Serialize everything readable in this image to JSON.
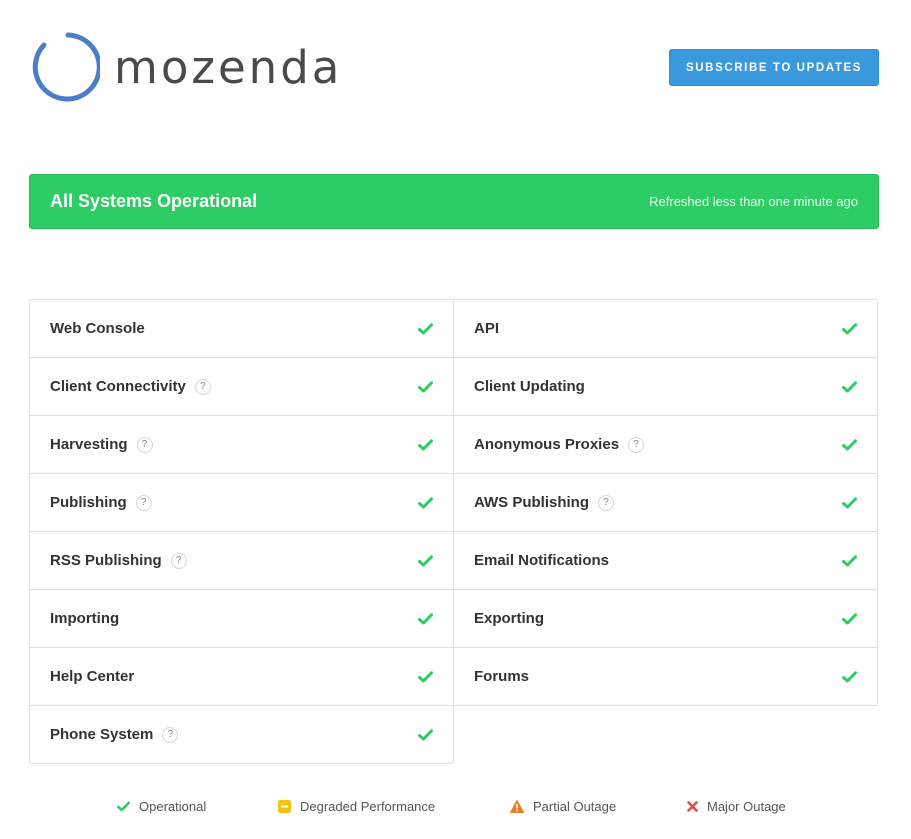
{
  "header": {
    "logo_text": "mozenda",
    "subscribe_label": "SUBSCRIBE TO UPDATES"
  },
  "banner": {
    "title": "All Systems Operational",
    "refresh_text": "Refreshed less than one minute ago",
    "color": "#2ecc65"
  },
  "components": {
    "left": [
      {
        "name": "Web Console",
        "help": false,
        "status": "operational"
      },
      {
        "name": "Client Connectivity",
        "help": true,
        "status": "operational"
      },
      {
        "name": "Harvesting",
        "help": true,
        "status": "operational"
      },
      {
        "name": "Publishing",
        "help": true,
        "status": "operational"
      },
      {
        "name": "RSS Publishing",
        "help": true,
        "status": "operational"
      },
      {
        "name": "Importing",
        "help": false,
        "status": "operational"
      },
      {
        "name": "Help Center",
        "help": false,
        "status": "operational"
      },
      {
        "name": "Phone System",
        "help": true,
        "status": "operational"
      }
    ],
    "right": [
      {
        "name": "API",
        "help": false,
        "status": "operational"
      },
      {
        "name": "Client Updating",
        "help": false,
        "status": "operational"
      },
      {
        "name": "Anonymous Proxies",
        "help": true,
        "status": "operational"
      },
      {
        "name": "AWS Publishing",
        "help": true,
        "status": "operational"
      },
      {
        "name": "Email Notifications",
        "help": false,
        "status": "operational"
      },
      {
        "name": "Exporting",
        "help": false,
        "status": "operational"
      },
      {
        "name": "Forums",
        "help": false,
        "status": "operational"
      }
    ],
    "help_symbol": "?"
  },
  "legend": [
    {
      "label": "Operational",
      "icon": "check-icon",
      "color": "#2fcc66"
    },
    {
      "label": "Degraded Performance",
      "icon": "minus-icon",
      "color": "#f1c40f"
    },
    {
      "label": "Partial Outage",
      "icon": "warning-icon",
      "color": "#e67e22"
    },
    {
      "label": "Major Outage",
      "icon": "x-icon",
      "color": "#e74c3c"
    }
  ]
}
